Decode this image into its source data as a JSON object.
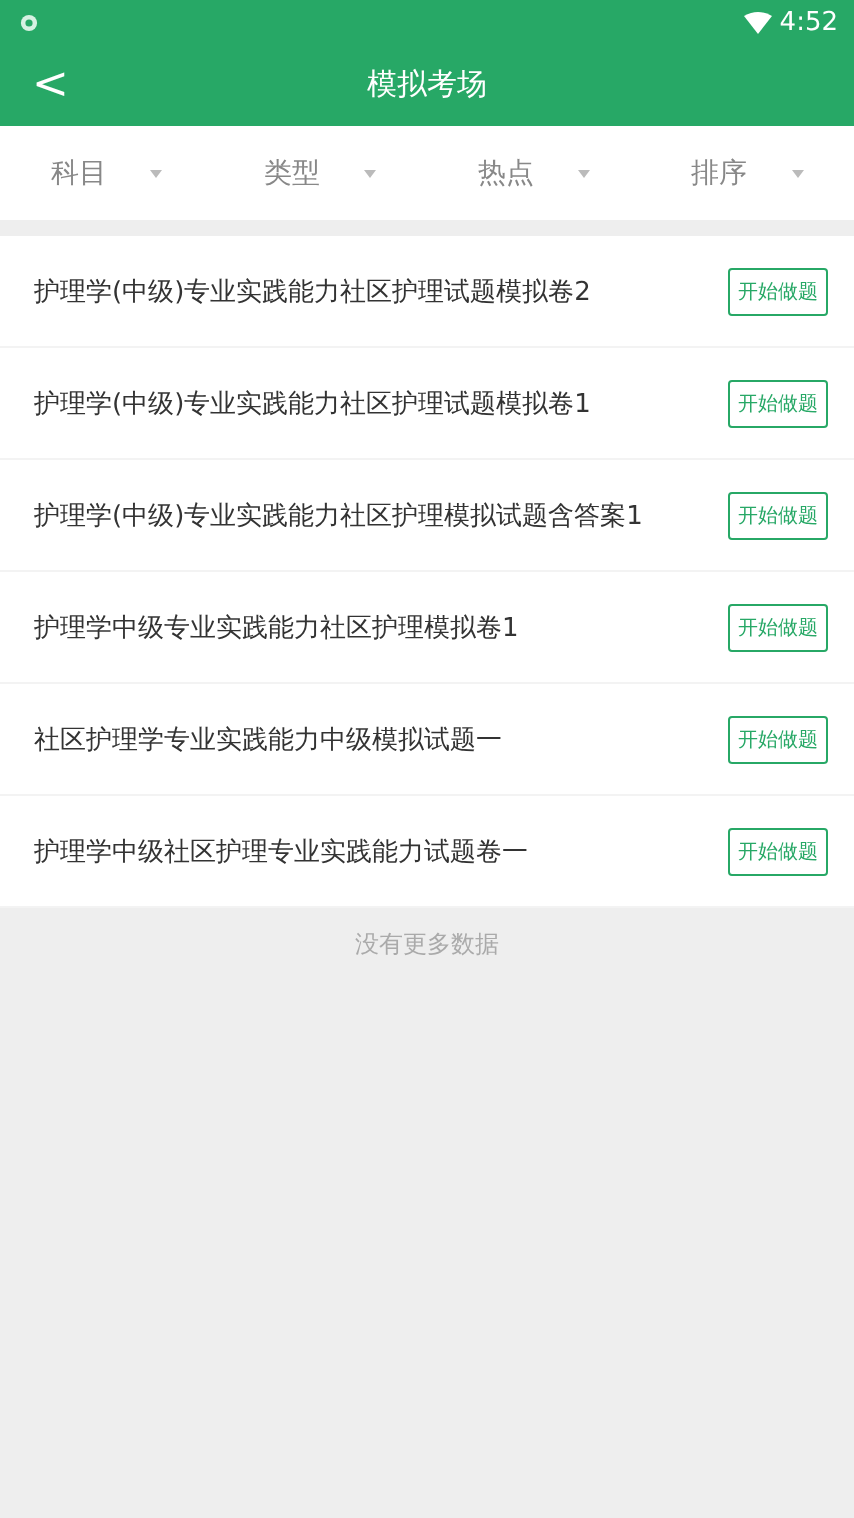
{
  "status_bar": {
    "time": "4:52"
  },
  "header": {
    "back": "<",
    "title": "模拟考场"
  },
  "filters": [
    {
      "label": "科目"
    },
    {
      "label": "类型"
    },
    {
      "label": "热点"
    },
    {
      "label": "排序"
    }
  ],
  "items": [
    {
      "title": "护理学(中级)专业实践能力社区护理试题模拟卷2",
      "action": "开始做题"
    },
    {
      "title": "护理学(中级)专业实践能力社区护理试题模拟卷1",
      "action": "开始做题"
    },
    {
      "title": "护理学(中级)专业实践能力社区护理模拟试题含答案1",
      "action": "开始做题"
    },
    {
      "title": "护理学中级专业实践能力社区护理模拟卷1",
      "action": "开始做题"
    },
    {
      "title": "社区护理学专业实践能力中级模拟试题一",
      "action": "开始做题"
    },
    {
      "title": "护理学中级社区护理专业实践能力试题卷一",
      "action": "开始做题"
    }
  ],
  "footer": "没有更多数据"
}
